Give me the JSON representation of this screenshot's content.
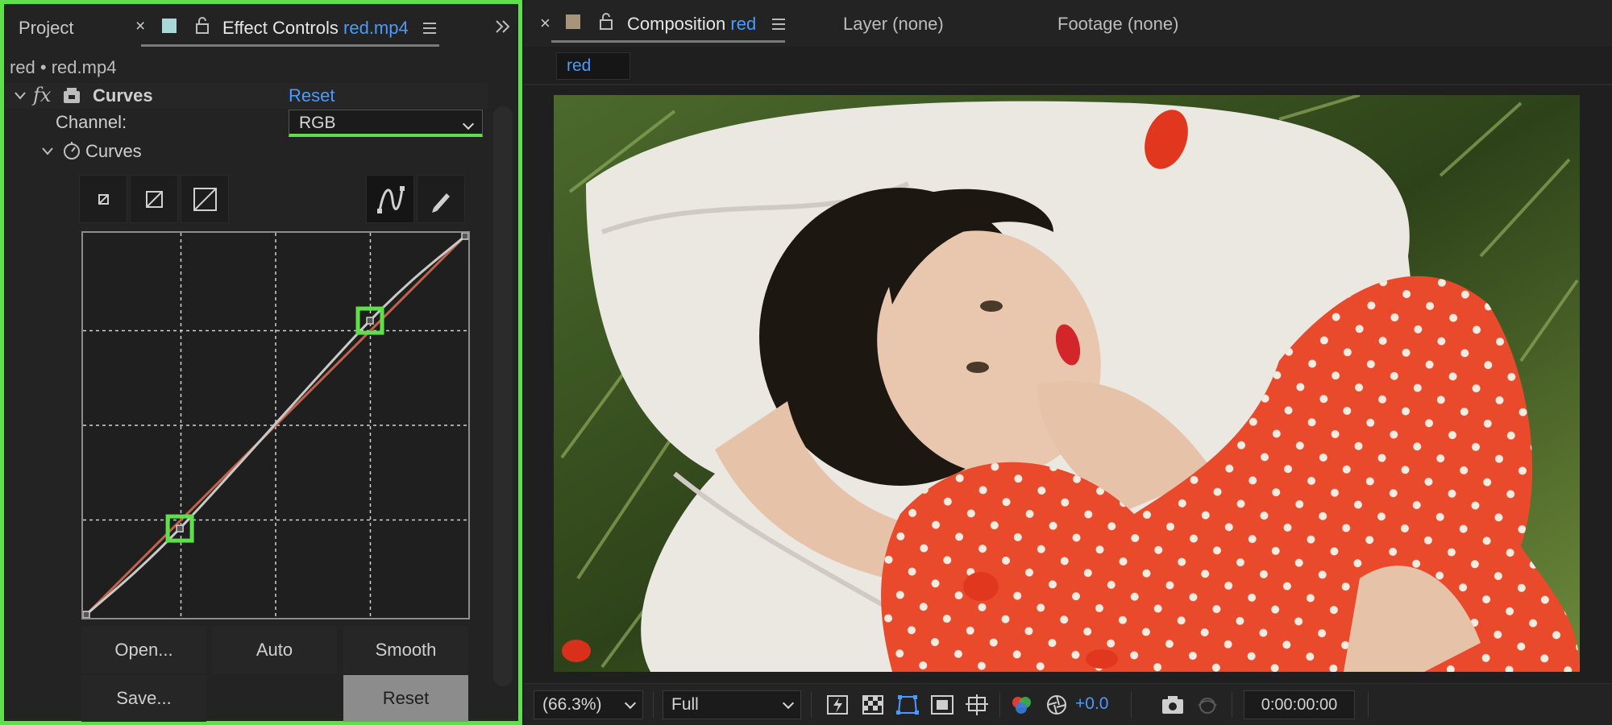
{
  "left_panel": {
    "tabs": {
      "project": "Project",
      "effect_controls_prefix": "Effect Controls",
      "effect_controls_layer": "red.mp4"
    },
    "breadcrumb": "red • red.mp4",
    "effect": {
      "fx_symbol": "fx",
      "name": "Curves",
      "reset_label": "Reset",
      "channel_label": "Channel:",
      "channel_value": "RGB",
      "curves_group_label": "Curves"
    },
    "curve": {
      "control_points_input": [
        [
          0,
          0
        ],
        [
          63,
          58
        ],
        [
          191,
          198
        ],
        [
          255,
          255
        ]
      ],
      "highlighted_points": [
        [
          63,
          58
        ],
        [
          191,
          198
        ]
      ]
    },
    "buttons": {
      "open": "Open...",
      "auto": "Auto",
      "smooth": "Smooth",
      "save": "Save...",
      "reset": "Reset"
    }
  },
  "right_panel": {
    "tabs": {
      "composition_prefix": "Composition",
      "composition_name": "red",
      "layer": "Layer (none)",
      "footage": "Footage (none)"
    },
    "comp_chip": "red",
    "status": {
      "zoom": "(66.3%)",
      "resolution": "Full",
      "exposure": "+0.0",
      "timecode": "0:00:00:00"
    }
  },
  "colors": {
    "highlight_green": "#5fe04a",
    "accent_blue": "#4a9bff"
  }
}
